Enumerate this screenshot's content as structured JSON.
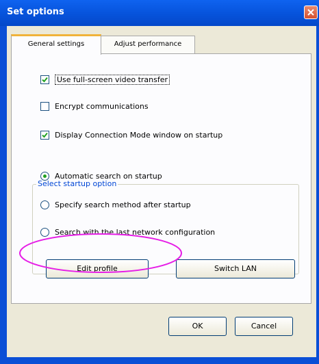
{
  "window": {
    "title": "Set options"
  },
  "tabs": [
    {
      "label": "General settings",
      "active": true
    },
    {
      "label": "Adjust performance",
      "active": false
    }
  ],
  "general": {
    "checkboxes": [
      {
        "label": "Use full-screen video transfer",
        "checked": true
      },
      {
        "label": "Encrypt communications",
        "checked": false
      },
      {
        "label": "Display Connection Mode window on startup",
        "checked": true
      }
    ],
    "startup_group": {
      "label": "Select startup option",
      "options": [
        {
          "label": "Automatic search on startup",
          "selected": true
        },
        {
          "label": "Specify search method after startup",
          "selected": false
        },
        {
          "label": "Search with the last network configuration",
          "selected": false
        }
      ]
    },
    "buttons": {
      "edit_profile": "Edit profile",
      "switch_lan": "Switch LAN"
    }
  },
  "footer": {
    "ok": "OK",
    "cancel": "Cancel"
  },
  "colors": {
    "title_bar": "#0754dd",
    "dialog_bg": "#ece9d8",
    "group_label": "#0046d5",
    "annotation": "#e61ee6"
  },
  "icons": {
    "close": "close-icon",
    "check": "checkmark-icon"
  }
}
